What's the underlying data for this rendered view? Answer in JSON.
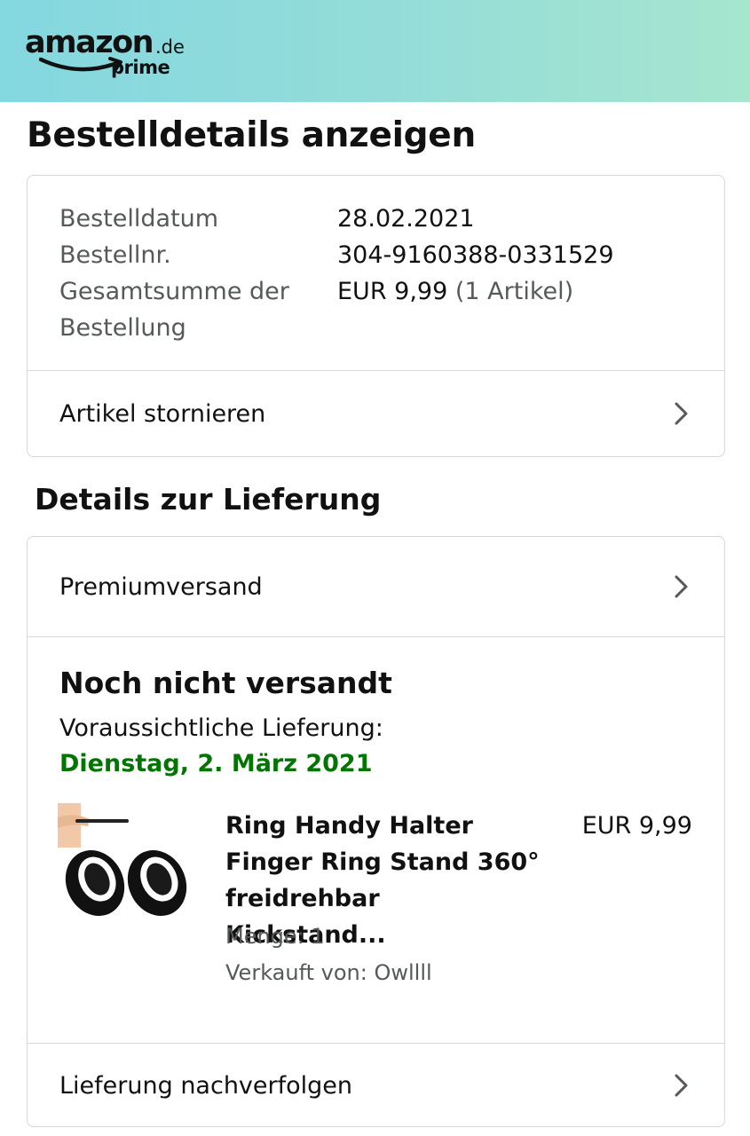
{
  "header": {
    "logo_wordmark": "amazon",
    "logo_tld": ".de",
    "logo_prime": "prime",
    "background_colors": [
      "#84d8e0",
      "#a6e6cf"
    ]
  },
  "page_title": "Bestelldetails anzeigen",
  "order_summary": {
    "date_label": "Bestelldatum",
    "date_value": "28.02.2021",
    "number_label": "Bestellnr.",
    "number_value": "304-9160388-0331529",
    "total_label": "Gesamtsumme der Bestellung",
    "total_value": "EUR 9,99",
    "total_items": "(1 Artikel)",
    "cancel_link": "Artikel stornieren"
  },
  "delivery_section": {
    "heading": "Details zur Lieferung",
    "shipping_method": "Premiumversand",
    "status_title": "Noch nicht versandt",
    "eta_label": "Voraussichtliche Lieferung:",
    "eta_date": "Dienstag, 2. März 2021",
    "eta_color": "#007600",
    "product": {
      "title": "Ring Handy Halter Finger Ring Stand 360° freidrehbar Kickstand...",
      "price": "EUR 9,99",
      "quantity": "Menge: 1",
      "seller": "Verkauft von: Owllll"
    },
    "track_link": "Lieferung nachverfolgen"
  },
  "icons": {
    "chevron": "chevron-right-icon",
    "logo_smile": "amazon-smile-arrow-icon"
  }
}
